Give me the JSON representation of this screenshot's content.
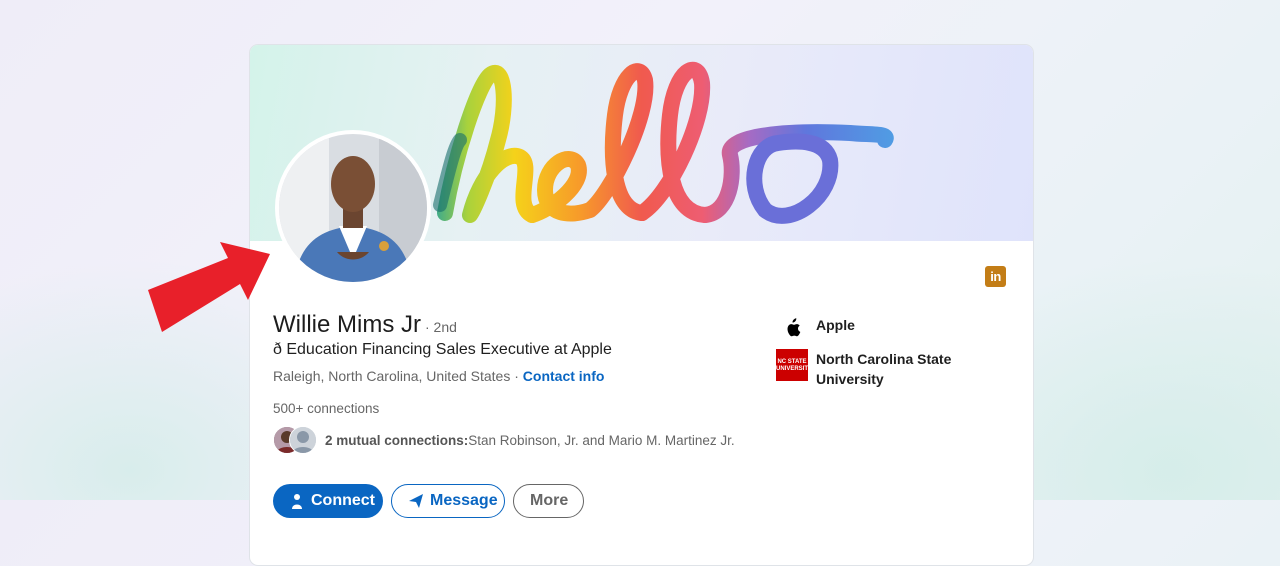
{
  "banner": {
    "text": "hello"
  },
  "profile": {
    "name": "Willie Mims Jr",
    "degree": "· 2nd",
    "headline": "ð Education Financing Sales Executive at Apple",
    "location": "Raleigh, North Carolina, United States",
    "separator": " · ",
    "contact_info": "Contact info",
    "connections": "500+ connections",
    "mutual_prefix": "2 mutual connections:",
    "mutual_names": " Stan Robinson, Jr. and Mario M. Martinez Jr."
  },
  "sidebar": {
    "company": "Apple",
    "school_line1": "North Carolina State",
    "school_line2": "University",
    "school_logo_text": "NC STATE UNIVERSITY"
  },
  "actions": {
    "connect": "Connect",
    "message": "Message",
    "more": "More"
  },
  "icons": {
    "linkedin": "in",
    "apple": "apple-icon",
    "arrow": "red-arrow-icon"
  },
  "colors": {
    "accent": "#0a66c2",
    "arrow": "#e8202a",
    "linkedin_badge": "#c37d16",
    "ncsu_red": "#cc0000"
  }
}
